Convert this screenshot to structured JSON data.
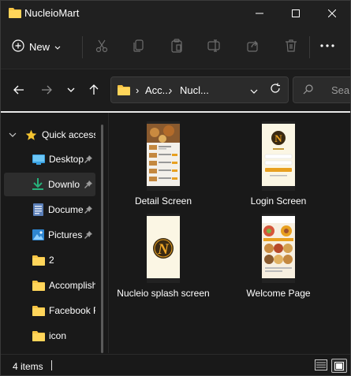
{
  "window": {
    "title": "NucleioMart"
  },
  "toolbar": {
    "new_label": "New"
  },
  "address": {
    "crumb1": "Acc...",
    "crumb2": "Nucl...",
    "search_placeholder": "Searc"
  },
  "sidebar": {
    "items": [
      {
        "label": "Quick access",
        "icon": "star-icon"
      },
      {
        "label": "Desktop",
        "icon": "desktop-icon",
        "pinned": true
      },
      {
        "label": "Downlo",
        "icon": "download-icon",
        "pinned": true,
        "selected": true
      },
      {
        "label": "Docume",
        "icon": "document-icon",
        "pinned": true
      },
      {
        "label": "Pictures",
        "icon": "pictures-icon",
        "pinned": true
      },
      {
        "label": "2",
        "icon": "folder-icon"
      },
      {
        "label": "Accomplish",
        "icon": "folder-icon"
      },
      {
        "label": "Facebook F",
        "icon": "folder-icon"
      },
      {
        "label": "icon",
        "icon": "folder-icon"
      }
    ]
  },
  "files": [
    {
      "name": "Detail Screen"
    },
    {
      "name": "Login Screen"
    },
    {
      "name": "Nucleio splash screen"
    },
    {
      "name": "Welcome Page"
    }
  ],
  "status": {
    "count": "4 items"
  },
  "colors": {
    "accent_yellow": "#f4c430",
    "folder": "#f6c343",
    "logo_orange": "#e8a020",
    "logo_bg": "#3a2a12"
  }
}
